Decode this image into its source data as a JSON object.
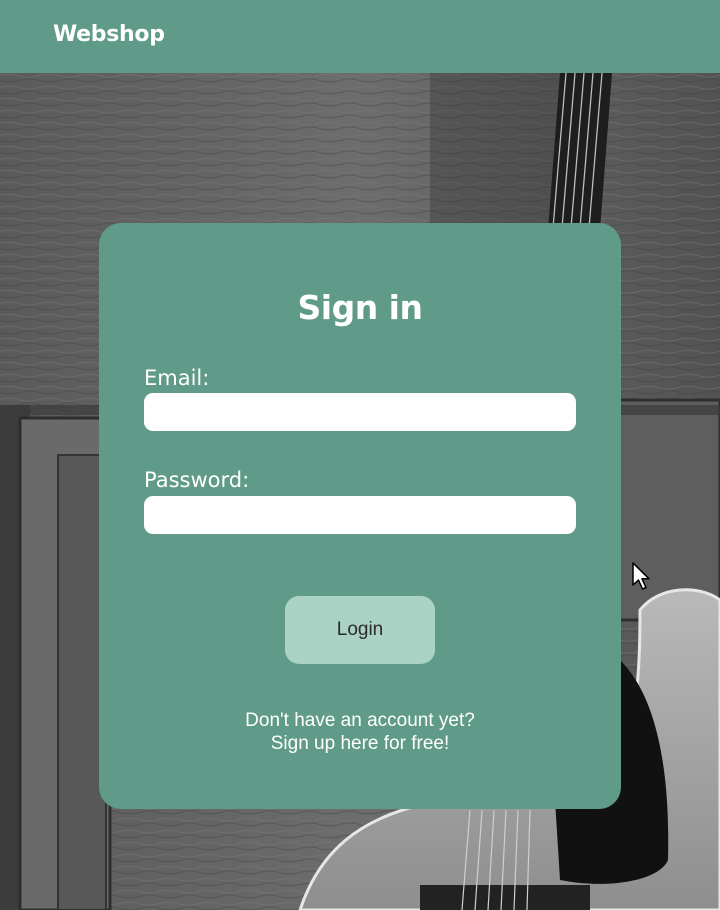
{
  "header": {
    "brand": "Webshop"
  },
  "signin": {
    "title": "Sign in",
    "email_label": "Email:",
    "email_value": "",
    "password_label": "Password:",
    "password_value": "",
    "login_label": "Login",
    "no_account_text": "Don't have an account yet?",
    "signup_link_text": "Sign up here for free!"
  },
  "icons": {
    "cursor": "mouse-pointer-icon"
  },
  "colors": {
    "brand_green": "#5f9b88",
    "button_light_green": "#aad2c5",
    "input_background": "#ffffff",
    "text_on_green": "#ffffff"
  }
}
